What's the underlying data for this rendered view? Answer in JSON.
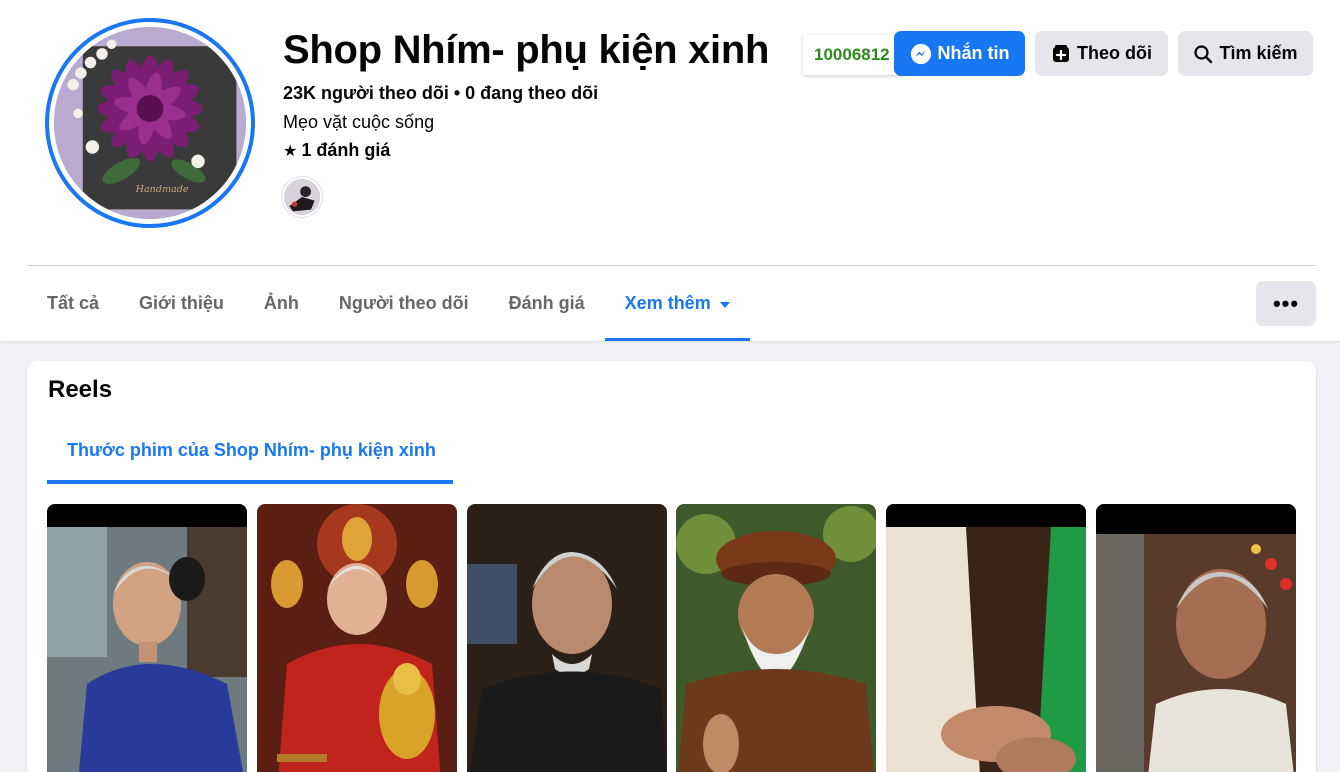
{
  "profile": {
    "name": "Shop Nhím- phụ kiện xinh",
    "followers_line": "23K người theo dõi • 0 đang theo dõi",
    "category": "Mẹo vặt cuộc sống",
    "rating": "1 đánh giá",
    "id_badge": "10006812"
  },
  "actions": {
    "message": "Nhắn tin",
    "follow": "Theo dõi",
    "search": "Tìm kiếm"
  },
  "tabs": [
    {
      "label": "Tất cả"
    },
    {
      "label": "Giới thiệu"
    },
    {
      "label": "Ảnh"
    },
    {
      "label": "Người theo dõi"
    },
    {
      "label": "Đánh giá"
    },
    {
      "label": "Xem thêm"
    }
  ],
  "more_button": "•••",
  "reels": {
    "title": "Reels",
    "tab_label": "Thước phim của Shop Nhím- phụ kiện xinh",
    "items": [
      {
        "label": "reel-1"
      },
      {
        "label": "reel-2"
      },
      {
        "label": "reel-3"
      },
      {
        "label": "reel-4"
      },
      {
        "label": "reel-5"
      },
      {
        "label": "reel-6"
      }
    ]
  },
  "colors": {
    "accent": "#1877f2",
    "secondary_button": "#e4e6eb",
    "page_background": "#f0f2f5",
    "id_badge_text": "#2e8b1e"
  }
}
